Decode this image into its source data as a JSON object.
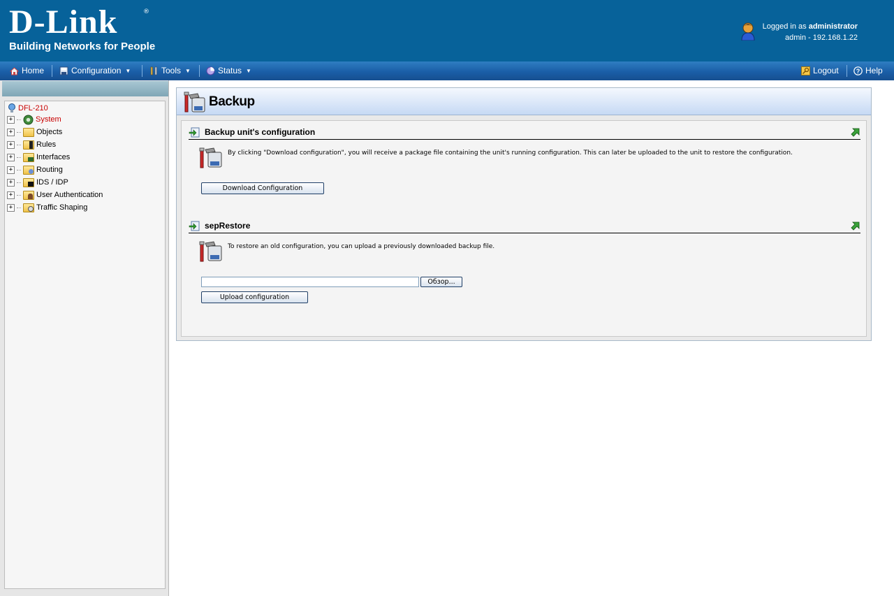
{
  "header": {
    "logo_text": "D-Link",
    "logo_reg": "®",
    "tagline": "Building Networks for People",
    "logged_in_prefix": "Logged in as",
    "user": "administrator",
    "user_line2": "admin - 192.168.1.22"
  },
  "menu": {
    "home": "Home",
    "configuration": "Configuration",
    "tools": "Tools",
    "status": "Status",
    "logout": "Logout",
    "help": "Help"
  },
  "tree": {
    "root": "DFL-210",
    "items": [
      {
        "label": "System"
      },
      {
        "label": "Objects"
      },
      {
        "label": "Rules"
      },
      {
        "label": "Interfaces"
      },
      {
        "label": "Routing"
      },
      {
        "label": "IDS / IDP"
      },
      {
        "label": "User Authentication"
      },
      {
        "label": "Traffic Shaping"
      }
    ]
  },
  "page": {
    "title": "Backup",
    "backup_section": {
      "title": "Backup unit's configuration",
      "text": "By clicking \"Download configuration\", you will receive a package file containing the unit's running configuration. This can later be uploaded to the unit to restore the configuration.",
      "button": "Download Configuration"
    },
    "restore_section": {
      "title": "sepRestore",
      "text": "To restore an old configuration, you can upload a previously downloaded backup file.",
      "file_value": "",
      "browse_button": "Обзор...",
      "upload_button": "Upload configuration"
    }
  },
  "colors": {
    "header_bg": "#07629a",
    "menubar": "#1a5ea7",
    "selected_text": "#c80000"
  }
}
